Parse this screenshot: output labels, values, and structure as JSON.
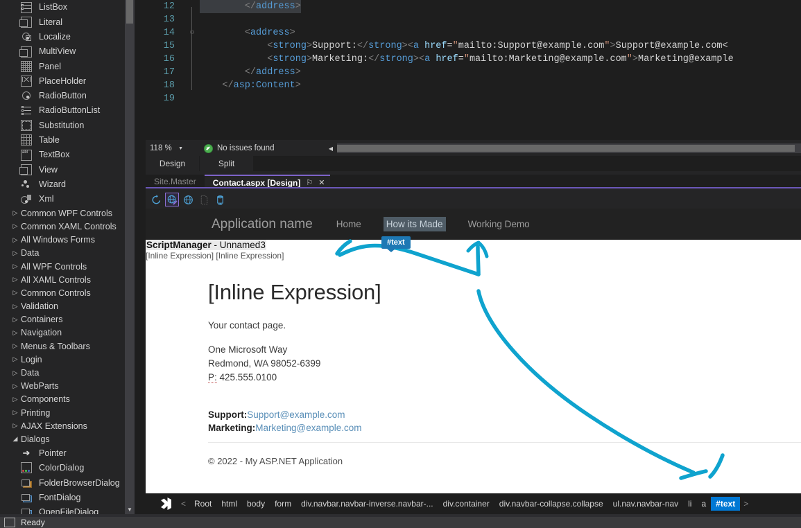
{
  "toolbox": {
    "items": [
      {
        "label": "ListBox",
        "icon": "listbox-icon"
      },
      {
        "label": "Literal",
        "icon": "literal-icon"
      },
      {
        "label": "Localize",
        "icon": "localize-icon"
      },
      {
        "label": "MultiView",
        "icon": "multiview-icon"
      },
      {
        "label": "Panel",
        "icon": "panel-icon"
      },
      {
        "label": "PlaceHolder",
        "icon": "placeholder-icon"
      },
      {
        "label": "RadioButton",
        "icon": "radiobutton-icon"
      },
      {
        "label": "RadioButtonList",
        "icon": "radiobuttonlist-icon"
      },
      {
        "label": "Substitution",
        "icon": "substitution-icon"
      },
      {
        "label": "Table",
        "icon": "table-icon"
      },
      {
        "label": "TextBox",
        "icon": "textbox-icon"
      },
      {
        "label": "View",
        "icon": "view-icon"
      },
      {
        "label": "Wizard",
        "icon": "wizard-icon"
      },
      {
        "label": "Xml",
        "icon": "xml-icon"
      }
    ],
    "groups": [
      {
        "label": "Common WPF Controls",
        "expanded": false
      },
      {
        "label": "Common XAML Controls",
        "expanded": false
      },
      {
        "label": "All Windows Forms",
        "expanded": false
      },
      {
        "label": "Data",
        "expanded": false
      },
      {
        "label": "All WPF Controls",
        "expanded": false
      },
      {
        "label": "All XAML Controls",
        "expanded": false
      },
      {
        "label": "Common Controls",
        "expanded": false
      },
      {
        "label": "Validation",
        "expanded": false
      },
      {
        "label": "Containers",
        "expanded": false
      },
      {
        "label": "Navigation",
        "expanded": false
      },
      {
        "label": "Menus & Toolbars",
        "expanded": false
      },
      {
        "label": "Login",
        "expanded": false
      },
      {
        "label": "Data",
        "expanded": false
      },
      {
        "label": "WebParts",
        "expanded": false
      },
      {
        "label": "Components",
        "expanded": false
      },
      {
        "label": "Printing",
        "expanded": false
      },
      {
        "label": "AJAX Extensions",
        "expanded": false
      },
      {
        "label": "Dialogs",
        "expanded": true
      }
    ],
    "dialog_items": [
      {
        "label": "Pointer",
        "icon": "pointer-icon"
      },
      {
        "label": "ColorDialog",
        "icon": "colordialog-icon"
      },
      {
        "label": "FolderBrowserDialog",
        "icon": "folderbrowserdialog-icon"
      },
      {
        "label": "FontDialog",
        "icon": "fontdialog-icon"
      },
      {
        "label": "OpenFileDialog",
        "icon": "openfiledialog-icon"
      }
    ],
    "expand_collapsed_glyph": "▷",
    "expand_expanded_glyph": "◢",
    "scroll_down_glyph": "▼"
  },
  "editor": {
    "lines": [
      {
        "num": "12",
        "text": "        </address>",
        "selected": true,
        "fold": ""
      },
      {
        "num": "13",
        "text": "",
        "selected": false,
        "fold": ""
      },
      {
        "num": "14",
        "text": "        <address>",
        "selected": false,
        "fold": "minus"
      },
      {
        "num": "15",
        "text": "            <strong>Support:</strong><a href=\"mailto:Support@example.com\">Support@example.com<",
        "selected": false,
        "fold": ""
      },
      {
        "num": "16",
        "text": "            <strong>Marketing:</strong><a href=\"mailto:Marketing@example.com\">Marketing@example",
        "selected": false,
        "fold": ""
      },
      {
        "num": "17",
        "text": "        </address>",
        "selected": false,
        "fold": ""
      },
      {
        "num": "18",
        "text": "    </asp:Content>",
        "selected": false,
        "fold": ""
      },
      {
        "num": "19",
        "text": "",
        "selected": false,
        "fold": ""
      }
    ],
    "status": {
      "zoom": "118 %",
      "issues": "No issues found",
      "issues_icon": "check-circle-icon"
    },
    "view_tabs": [
      {
        "label": "Design",
        "active": false
      },
      {
        "label": "Split",
        "active": false
      }
    ]
  },
  "designer": {
    "doc_tabs": [
      {
        "label": "Site.Master",
        "active": false
      },
      {
        "label": "Contact.aspx [Design]",
        "active": true
      }
    ],
    "tab_pin_glyph": "⚐",
    "tab_close_glyph": "✕",
    "toolbar_buttons": [
      {
        "name": "refresh-icon",
        "selected": false
      },
      {
        "name": "browser-edit-icon",
        "selected": true
      },
      {
        "name": "globe-icon",
        "selected": false
      },
      {
        "name": "page-icon",
        "selected": false
      },
      {
        "name": "database-icon",
        "selected": false
      }
    ]
  },
  "surface": {
    "navbar": {
      "brand": "Application name",
      "links": [
        {
          "label": "Home",
          "highlighted": false
        },
        {
          "label": "How its Made",
          "highlighted": true
        },
        {
          "label": "Working Demo",
          "highlighted": false
        }
      ]
    },
    "scriptmanager": {
      "name": "ScriptManager",
      "separator": " - ",
      "instance": "Unnamed3",
      "inline": "[Inline Expression] [Inline Expression]"
    },
    "heading": "[Inline Expression]",
    "lead": "Your contact page.",
    "address": {
      "line1": "One Microsoft Way",
      "line2": "Redmond, WA 98052-6399",
      "phone_label": "P:",
      "phone": "425.555.0100"
    },
    "contacts": [
      {
        "label": "Support:",
        "email": "Support@example.com"
      },
      {
        "label": "Marketing:",
        "email": "Marketing@example.com"
      }
    ],
    "footer": "© 2022 - My ASP.NET Application"
  },
  "annotation": {
    "tooltip": "#text",
    "ink_color": "#0fa3ce"
  },
  "breadcrumbs": {
    "logo": "visual-studio-logo",
    "prev_glyph": "<",
    "next_glyph": ">",
    "items": [
      {
        "label": "Root",
        "active": false
      },
      {
        "label": "html",
        "active": false
      },
      {
        "label": "body",
        "active": false
      },
      {
        "label": "form",
        "active": false
      },
      {
        "label": "div.navbar.navbar-inverse.navbar-...",
        "active": false
      },
      {
        "label": "div.container",
        "active": false
      },
      {
        "label": "div.navbar-collapse.collapse",
        "active": false
      },
      {
        "label": "ul.nav.navbar-nav",
        "active": false
      },
      {
        "label": "li",
        "active": false
      },
      {
        "label": "a",
        "active": false
      },
      {
        "label": "#text",
        "active": true
      }
    ]
  },
  "statusbar": {
    "text": "Ready"
  }
}
